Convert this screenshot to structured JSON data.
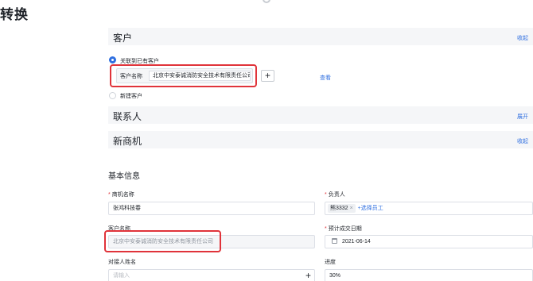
{
  "page": {
    "title": "转换"
  },
  "sections": {
    "customer": {
      "title": "客户",
      "toggle": "收起"
    },
    "contact": {
      "title": "联系人",
      "toggle": "展开"
    },
    "opportunity": {
      "title": "新商机",
      "toggle": "收起"
    }
  },
  "customer_choice": {
    "link_existing": "关联到已有客户",
    "customer_name_label": "客户名称",
    "customer_name_value": "北京中安泰诚消防安全技术有限责任公司",
    "view_link": "查看",
    "new_customer": "新建客户",
    "selected": "link_existing"
  },
  "basic_info": {
    "heading": "基本信息",
    "opportunity_name": {
      "label": "商机名称",
      "required": "*",
      "value": "张鸿科技春"
    },
    "owner": {
      "label": "负责人",
      "required": "*",
      "tag": "熊3332",
      "tag_remove": "×",
      "add": "+选择员工"
    },
    "customer_name": {
      "label": "客户名称",
      "value": "北京中安泰诚消防安全技术有限责任公司"
    },
    "close_date": {
      "label": "预计成交日期",
      "required": "*",
      "value": "2021-06-14"
    },
    "contact_name": {
      "label": "对接人姓名",
      "placeholder": "请输入"
    },
    "progress": {
      "label": "进度",
      "value": "30%"
    }
  },
  "icons": {
    "plus": "+",
    "calendar": "calendar-icon"
  },
  "colors": {
    "accent": "#2f6fe0",
    "highlight": "#e0333a",
    "section_bg": "#f5f6f8"
  }
}
